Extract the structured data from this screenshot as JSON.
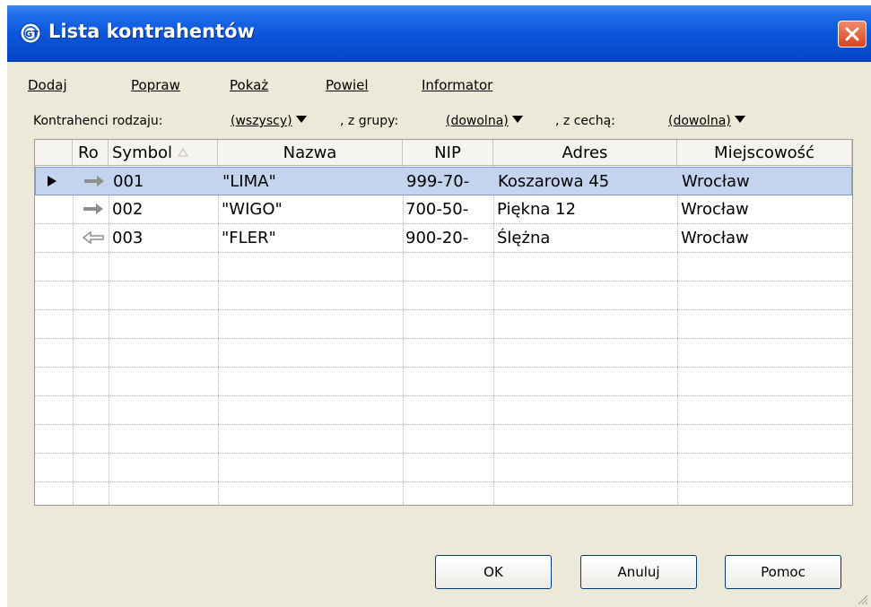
{
  "window": {
    "title": "Lista kontrahentów",
    "icon": "app-logo-icon",
    "close_icon": "close-icon"
  },
  "menu": {
    "add": "Dodaj",
    "edit": "Popraw",
    "show": "Pokaż",
    "duplicate": "Powiel",
    "info": "Informator"
  },
  "filters": {
    "type_label": "Kontrahenci rodzaju:",
    "type_value": "(wszyscy)",
    "group_label": ", z grupy:",
    "group_value": "(dowolna)",
    "feature_label": ", z cechą:",
    "feature_value": "(dowolna)"
  },
  "table": {
    "columns": {
      "ro": "Ro",
      "symbol": "Symbol",
      "name": "Nazwa",
      "nip": "NIP",
      "address": "Adres",
      "city": "Miejscowość"
    },
    "sort_icon": "sort-ascending-icon",
    "rows": [
      {
        "selected": true,
        "direction_icon": "arrow-right-icon",
        "symbol": "001",
        "name": "\"LIMA\"",
        "nip": "999-70-",
        "address": "Koszarowa 45",
        "city": "Wrocław"
      },
      {
        "selected": false,
        "direction_icon": "arrow-right-icon",
        "symbol": "002",
        "name": "\"WIGO\"",
        "nip": "700-50-",
        "address": "Piękna 12",
        "city": "Wrocław"
      },
      {
        "selected": false,
        "direction_icon": "arrow-left-icon",
        "symbol": "003",
        "name": "\"FLER\"",
        "nip": "900-20-",
        "address": "Ślężna",
        "city": "Wrocław"
      }
    ]
  },
  "buttons": {
    "ok": "OK",
    "cancel": "Anuluj",
    "help": "Pomoc"
  },
  "colors": {
    "titlebar": "#0a55d8",
    "selection": "#c5d4ee",
    "dialog_bg": "#ece9d8"
  }
}
